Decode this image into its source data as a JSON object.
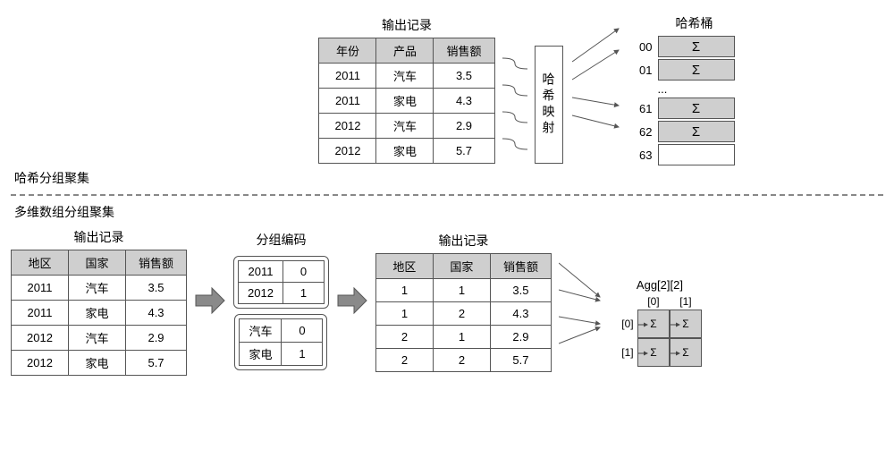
{
  "top": {
    "table_title": "输出记录",
    "bucket_title": "哈希桶",
    "headers": [
      "年份",
      "产品",
      "销售额"
    ],
    "rows": [
      [
        "2011",
        "汽车",
        "3.5"
      ],
      [
        "2011",
        "家电",
        "4.3"
      ],
      [
        "2012",
        "汽车",
        "2.9"
      ],
      [
        "2012",
        "家电",
        "5.7"
      ]
    ],
    "hash_label": "哈希映射",
    "buckets": [
      "00",
      "01",
      "61",
      "62",
      "63"
    ],
    "ellipsis": "...",
    "sigma": "Σ",
    "caption": "哈希分组聚集"
  },
  "bottom": {
    "caption": "多维数组分组聚集",
    "left_title": "输出记录",
    "left_headers": [
      "地区",
      "国家",
      "销售额"
    ],
    "left_rows": [
      [
        "2011",
        "汽车",
        "3.5"
      ],
      [
        "2011",
        "家电",
        "4.3"
      ],
      [
        "2012",
        "汽车",
        "2.9"
      ],
      [
        "2012",
        "家电",
        "5.7"
      ]
    ],
    "code_title": "分组编码",
    "code1": [
      [
        "2011",
        "0"
      ],
      [
        "2012",
        "1"
      ]
    ],
    "code2": [
      [
        "汽车",
        "0"
      ],
      [
        "家电",
        "1"
      ]
    ],
    "right_title": "输出记录",
    "right_headers": [
      "地区",
      "国家",
      "销售额"
    ],
    "right_rows": [
      [
        "1",
        "1",
        "3.5"
      ],
      [
        "1",
        "2",
        "4.3"
      ],
      [
        "2",
        "1",
        "2.9"
      ],
      [
        "2",
        "2",
        "5.7"
      ]
    ],
    "agg_label": "Agg[2][2]",
    "col_idx": [
      "[0]",
      "[1]"
    ],
    "row_idx": [
      "[0]",
      "[1]"
    ],
    "sigma": "Σ"
  }
}
